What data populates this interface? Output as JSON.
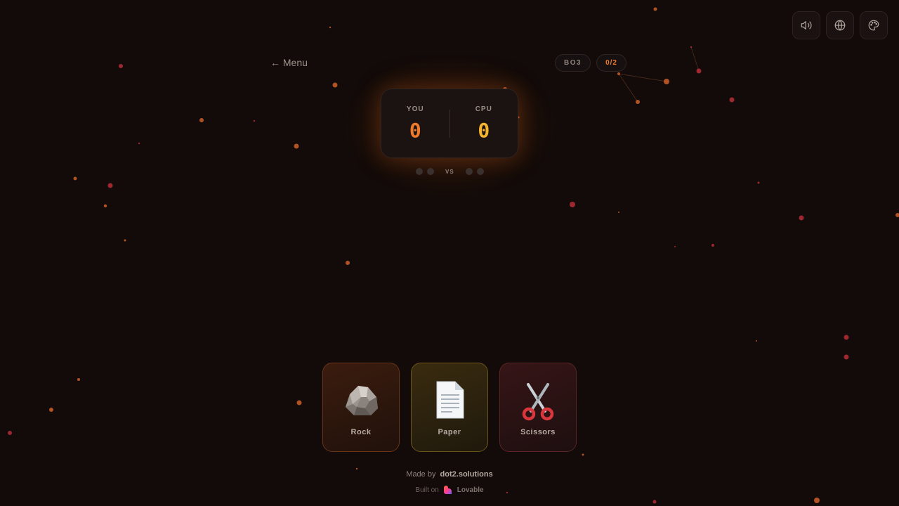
{
  "header": {
    "menu_label": "← Menu",
    "icons": [
      "speaker-icon",
      "globe-icon",
      "palette-icon"
    ]
  },
  "match": {
    "format_badge": "BO3",
    "progress_badge": "0/2"
  },
  "scoreboard": {
    "you_label": "YOU",
    "you_score": "0",
    "cpu_label": "CPU",
    "cpu_score": "0",
    "vs_label": "VS"
  },
  "choices": [
    {
      "label": "Rock",
      "icon": "rock-icon"
    },
    {
      "label": "Paper",
      "icon": "paper-icon"
    },
    {
      "label": "Scissors",
      "icon": "scissors-icon"
    }
  ],
  "footer": {
    "made_by_prefix": "Made by",
    "made_by_brand": "dot2.solutions",
    "built_on_prefix": "Built on",
    "built_on_brand": "Lovable"
  },
  "colors": {
    "background": "#120b09",
    "accent_orange": "#f07a2a",
    "accent_yellow": "#f4b52c",
    "particle_orange": "#d9642a",
    "particle_red": "#c0303a"
  }
}
